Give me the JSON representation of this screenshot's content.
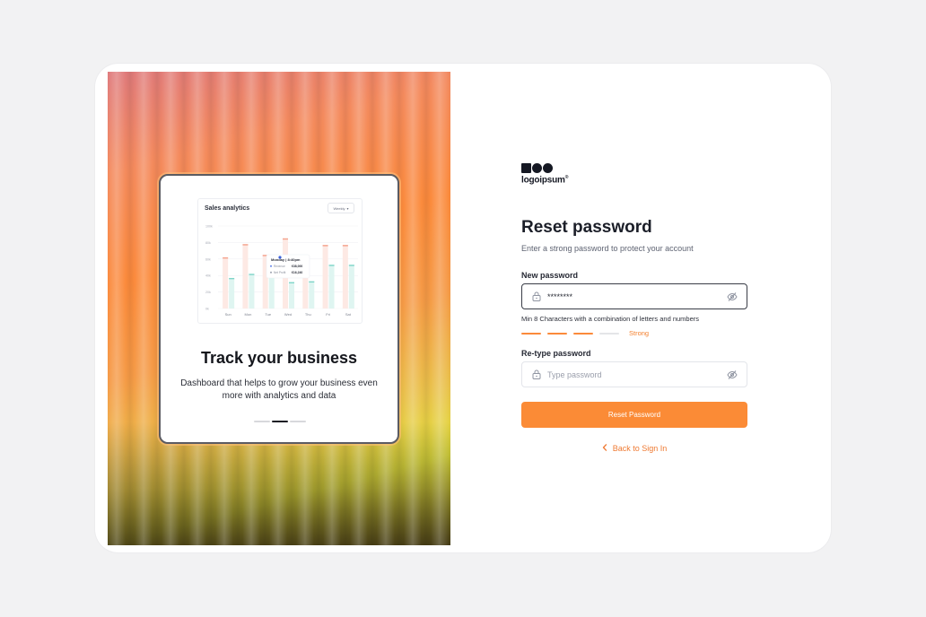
{
  "hero": {
    "analytics_title": "Sales analytics",
    "period_select": "Weekly",
    "y_ticks": [
      "100k",
      "80k",
      "60k",
      "40k",
      "20k",
      "0k"
    ],
    "tooltip": {
      "title": "Monday | 8:40pm",
      "rows": [
        {
          "label": "Revenue",
          "value": "€38,000"
        },
        {
          "label": "Net Profit",
          "value": "€16,240"
        }
      ]
    },
    "title": "Track your business",
    "subtitle": "Dashboard that helps to grow your business even more with analytics and data",
    "pager_active": 1
  },
  "chart_data": {
    "type": "bar",
    "title": "Sales analytics",
    "categories": [
      "Sun",
      "Mon",
      "Tue",
      "Wed",
      "Thu",
      "Fri",
      "Sat"
    ],
    "ylim": [
      0,
      100
    ],
    "series": [
      {
        "name": "Revenue",
        "color": "#f4a28c",
        "values": [
          62,
          78,
          65,
          85,
          42,
          77,
          77
        ]
      },
      {
        "name": "Net Profit",
        "color": "#7fd5c8",
        "values": [
          37,
          42,
          40,
          32,
          33,
          53,
          53
        ]
      }
    ]
  },
  "logo": {
    "text": "logoipsum",
    "mark": "®"
  },
  "form": {
    "title": "Reset password",
    "subtitle": "Enter a strong password to protect your account",
    "new_password_label": "New password",
    "new_password_value": "********",
    "hint": "Min 8 Characters with a combination of letters and numbers",
    "strength_label": "Strong",
    "strength_level": 3,
    "strength_total": 4,
    "retype_label": "Re-type password",
    "retype_placeholder": "Type password",
    "submit_label": "Reset Password",
    "back_label": "Back to Sign In"
  },
  "colors": {
    "accent": "#fb8b36",
    "accent_text": "#ef7a33",
    "dark": "#1b1e28"
  },
  "icons": {
    "field_left": "lock-icon",
    "field_right": "eye-off-icon",
    "back": "chevron-left-icon"
  }
}
